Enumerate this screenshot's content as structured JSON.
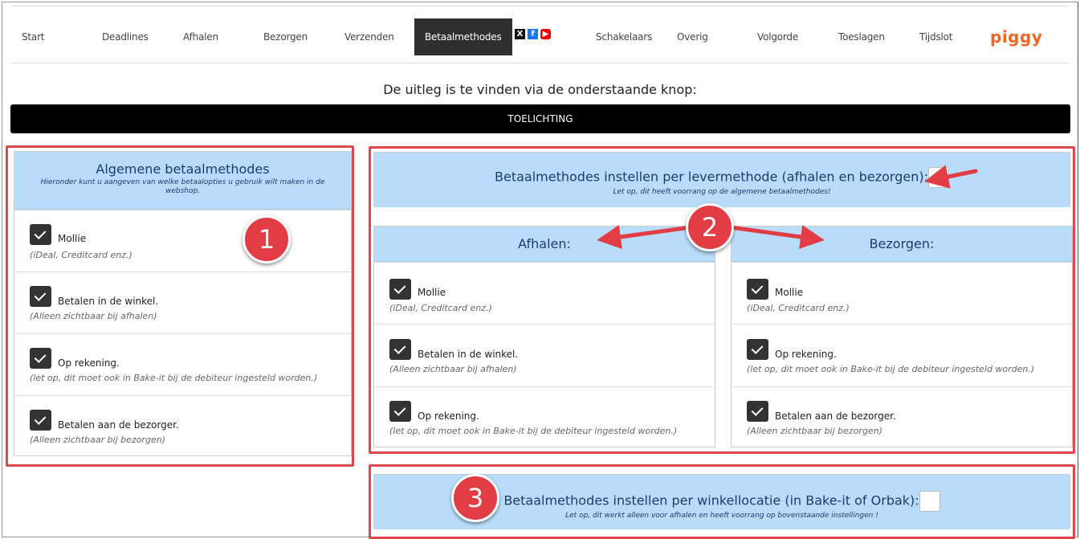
{
  "nav": {
    "items": [
      {
        "label": "Start"
      },
      {
        "label": "Deadlines"
      },
      {
        "label": "Afhalen"
      },
      {
        "label": "Bezorgen"
      },
      {
        "label": "Verzenden"
      },
      {
        "label": "Betaalmethodes",
        "active": true
      },
      {
        "label": "Schakelaars"
      },
      {
        "label": "Overig"
      },
      {
        "label": "Volgorde"
      },
      {
        "label": "Toeslagen"
      },
      {
        "label": "Tijdslot"
      }
    ],
    "social": [
      "x-icon",
      "facebook-icon",
      "youtube-icon"
    ],
    "brand": "piggy"
  },
  "intro": {
    "text": "De uitleg is te vinden via de onderstaande knop:",
    "button_label": "TOELICHTING"
  },
  "general": {
    "title": "Algemene betaalmethodes",
    "subtitle": "Hieronder kunt u aangeven van welke betaalopties u gebruik wilt maken in de webshop.",
    "options": [
      {
        "label": "Mollie",
        "desc": "(iDeal, Creditcard enz.)",
        "checked": true
      },
      {
        "label": "Betalen in de winkel.",
        "desc": "(Alleen zichtbaar bij afhalen)",
        "checked": true
      },
      {
        "label": "Op rekening.",
        "desc": "(let op, dit moet ook in Bake-it bij de debiteur ingesteld worden.)",
        "checked": true
      },
      {
        "label": "Betalen aan de bezorger.",
        "desc": "(Alleen zichtbaar bij bezorgen)",
        "checked": true
      }
    ]
  },
  "per_delivery": {
    "title": "Betaalmethodes instellen per levermethode (afhalen en bezorgen):",
    "subtitle": "Let op, dit heeft voorrang op de algemene betaalmethodes!",
    "enabled": false,
    "pickup": {
      "title": "Afhalen:",
      "options": [
        {
          "label": "Mollie",
          "desc": "(iDeal, Creditcard enz.)",
          "checked": true
        },
        {
          "label": "Betalen in de winkel.",
          "desc": "(Alleen zichtbaar bij afhalen)",
          "checked": true
        },
        {
          "label": "Op rekening.",
          "desc": "(let op, dit moet ook in Bake-it bij de debiteur ingesteld worden.)",
          "checked": true
        }
      ]
    },
    "delivery": {
      "title": "Bezorgen:",
      "options": [
        {
          "label": "Mollie",
          "desc": "(iDeal, Creditcard enz.)",
          "checked": true
        },
        {
          "label": "Op rekening.",
          "desc": "(let op, dit moet ook in Bake-it bij de debiteur ingesteld worden.)",
          "checked": true
        },
        {
          "label": "Betalen aan de bezorger.",
          "desc": "(Alleen zichtbaar bij bezorgen)",
          "checked": true
        }
      ]
    }
  },
  "per_location": {
    "title": "Betaalmethodes instellen per winkellocatie (in Bake-it of Orbak):",
    "subtitle": "Let op, dit werkt alleen voor afhalen en heeft voorrang op bovenstaande instellingen !",
    "enabled": false
  },
  "annotations": {
    "badge1": "1",
    "badge2": "2",
    "badge3": "3",
    "color": "#e0474c"
  }
}
